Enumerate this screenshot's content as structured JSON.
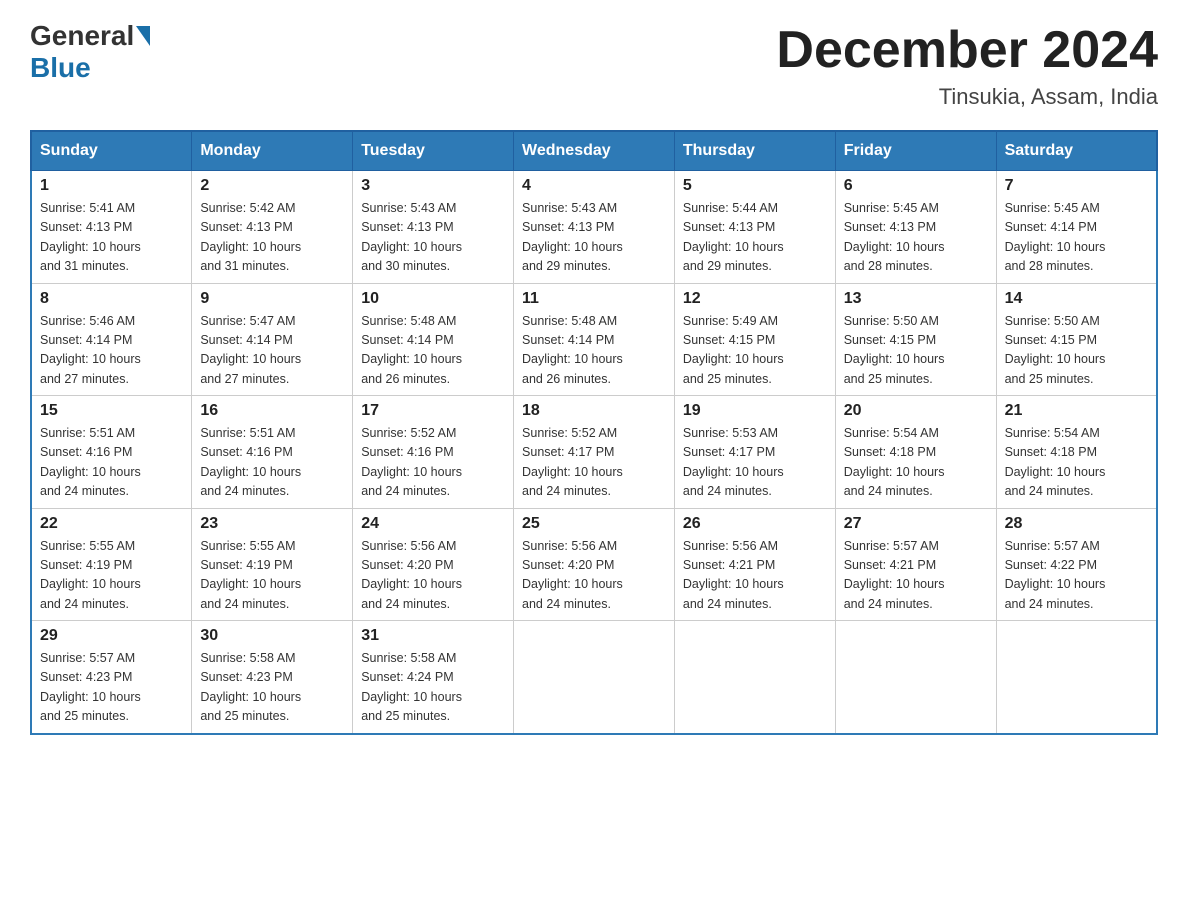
{
  "header": {
    "logo_general": "General",
    "logo_blue": "Blue",
    "month_title": "December 2024",
    "location": "Tinsukia, Assam, India"
  },
  "days_of_week": [
    "Sunday",
    "Monday",
    "Tuesday",
    "Wednesday",
    "Thursday",
    "Friday",
    "Saturday"
  ],
  "weeks": [
    [
      {
        "day": "1",
        "sunrise": "5:41 AM",
        "sunset": "4:13 PM",
        "daylight": "10 hours and 31 minutes."
      },
      {
        "day": "2",
        "sunrise": "5:42 AM",
        "sunset": "4:13 PM",
        "daylight": "10 hours and 31 minutes."
      },
      {
        "day": "3",
        "sunrise": "5:43 AM",
        "sunset": "4:13 PM",
        "daylight": "10 hours and 30 minutes."
      },
      {
        "day": "4",
        "sunrise": "5:43 AM",
        "sunset": "4:13 PM",
        "daylight": "10 hours and 29 minutes."
      },
      {
        "day": "5",
        "sunrise": "5:44 AM",
        "sunset": "4:13 PM",
        "daylight": "10 hours and 29 minutes."
      },
      {
        "day": "6",
        "sunrise": "5:45 AM",
        "sunset": "4:13 PM",
        "daylight": "10 hours and 28 minutes."
      },
      {
        "day": "7",
        "sunrise": "5:45 AM",
        "sunset": "4:14 PM",
        "daylight": "10 hours and 28 minutes."
      }
    ],
    [
      {
        "day": "8",
        "sunrise": "5:46 AM",
        "sunset": "4:14 PM",
        "daylight": "10 hours and 27 minutes."
      },
      {
        "day": "9",
        "sunrise": "5:47 AM",
        "sunset": "4:14 PM",
        "daylight": "10 hours and 27 minutes."
      },
      {
        "day": "10",
        "sunrise": "5:48 AM",
        "sunset": "4:14 PM",
        "daylight": "10 hours and 26 minutes."
      },
      {
        "day": "11",
        "sunrise": "5:48 AM",
        "sunset": "4:14 PM",
        "daylight": "10 hours and 26 minutes."
      },
      {
        "day": "12",
        "sunrise": "5:49 AM",
        "sunset": "4:15 PM",
        "daylight": "10 hours and 25 minutes."
      },
      {
        "day": "13",
        "sunrise": "5:50 AM",
        "sunset": "4:15 PM",
        "daylight": "10 hours and 25 minutes."
      },
      {
        "day": "14",
        "sunrise": "5:50 AM",
        "sunset": "4:15 PM",
        "daylight": "10 hours and 25 minutes."
      }
    ],
    [
      {
        "day": "15",
        "sunrise": "5:51 AM",
        "sunset": "4:16 PM",
        "daylight": "10 hours and 24 minutes."
      },
      {
        "day": "16",
        "sunrise": "5:51 AM",
        "sunset": "4:16 PM",
        "daylight": "10 hours and 24 minutes."
      },
      {
        "day": "17",
        "sunrise": "5:52 AM",
        "sunset": "4:16 PM",
        "daylight": "10 hours and 24 minutes."
      },
      {
        "day": "18",
        "sunrise": "5:52 AM",
        "sunset": "4:17 PM",
        "daylight": "10 hours and 24 minutes."
      },
      {
        "day": "19",
        "sunrise": "5:53 AM",
        "sunset": "4:17 PM",
        "daylight": "10 hours and 24 minutes."
      },
      {
        "day": "20",
        "sunrise": "5:54 AM",
        "sunset": "4:18 PM",
        "daylight": "10 hours and 24 minutes."
      },
      {
        "day": "21",
        "sunrise": "5:54 AM",
        "sunset": "4:18 PM",
        "daylight": "10 hours and 24 minutes."
      }
    ],
    [
      {
        "day": "22",
        "sunrise": "5:55 AM",
        "sunset": "4:19 PM",
        "daylight": "10 hours and 24 minutes."
      },
      {
        "day": "23",
        "sunrise": "5:55 AM",
        "sunset": "4:19 PM",
        "daylight": "10 hours and 24 minutes."
      },
      {
        "day": "24",
        "sunrise": "5:56 AM",
        "sunset": "4:20 PM",
        "daylight": "10 hours and 24 minutes."
      },
      {
        "day": "25",
        "sunrise": "5:56 AM",
        "sunset": "4:20 PM",
        "daylight": "10 hours and 24 minutes."
      },
      {
        "day": "26",
        "sunrise": "5:56 AM",
        "sunset": "4:21 PM",
        "daylight": "10 hours and 24 minutes."
      },
      {
        "day": "27",
        "sunrise": "5:57 AM",
        "sunset": "4:21 PM",
        "daylight": "10 hours and 24 minutes."
      },
      {
        "day": "28",
        "sunrise": "5:57 AM",
        "sunset": "4:22 PM",
        "daylight": "10 hours and 24 minutes."
      }
    ],
    [
      {
        "day": "29",
        "sunrise": "5:57 AM",
        "sunset": "4:23 PM",
        "daylight": "10 hours and 25 minutes."
      },
      {
        "day": "30",
        "sunrise": "5:58 AM",
        "sunset": "4:23 PM",
        "daylight": "10 hours and 25 minutes."
      },
      {
        "day": "31",
        "sunrise": "5:58 AM",
        "sunset": "4:24 PM",
        "daylight": "10 hours and 25 minutes."
      },
      null,
      null,
      null,
      null
    ]
  ],
  "labels": {
    "sunrise": "Sunrise:",
    "sunset": "Sunset:",
    "daylight": "Daylight:"
  }
}
